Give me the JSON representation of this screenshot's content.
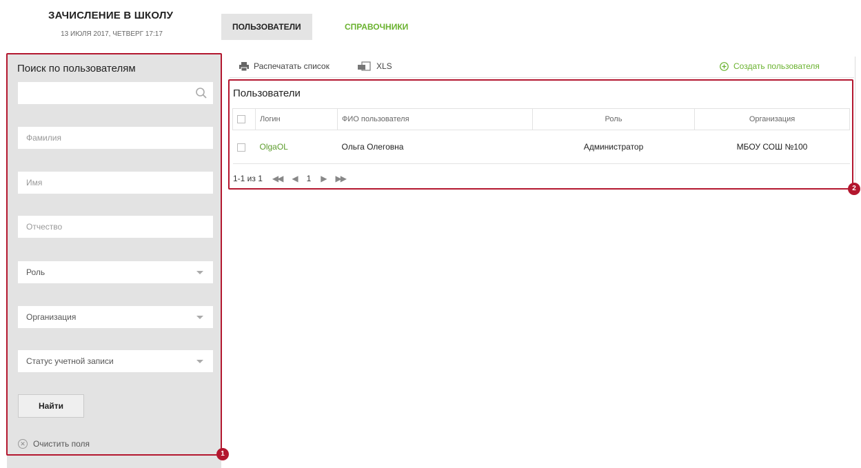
{
  "header": {
    "app_title": "ЗАЧИСЛЕНИЕ В ШКОЛУ",
    "date": "13 ИЮЛЯ 2017, ЧЕТВЕРГ 17:17"
  },
  "nav": {
    "users": "ПОЛЬЗОВАТЕЛИ",
    "references": "СПРАВОЧНИКИ"
  },
  "sidebar": {
    "title": "Поиск по пользователям",
    "search_value": "",
    "surname_placeholder": "Фамилия",
    "name_placeholder": "Имя",
    "patronymic_placeholder": "Отчество",
    "role_select": "Роль",
    "org_select": "Организация",
    "status_select": "Статус учетной записи",
    "find_button": "Найти",
    "clear_fields": "Очистить поля"
  },
  "toolbar": {
    "print": "Распечатать список",
    "xls": "XLS",
    "create_user": "Создать пользователя"
  },
  "users_panel": {
    "title": "Пользователи",
    "columns": {
      "login": "Логин",
      "fio": "ФИО пользователя",
      "role": "Роль",
      "organization": "Организация"
    },
    "rows": [
      {
        "login": "OlgaOL",
        "fio": "Ольга Олеговна",
        "role": "Администратор",
        "organization": "МБОУ СОШ №100"
      }
    ],
    "pagination": {
      "summary": "1-1 из 1",
      "current_page": "1"
    }
  },
  "callouts": {
    "sidebar": "1",
    "table": "2"
  },
  "colors": {
    "accent_green": "#6ab22f",
    "callout_red": "#b3162e"
  }
}
